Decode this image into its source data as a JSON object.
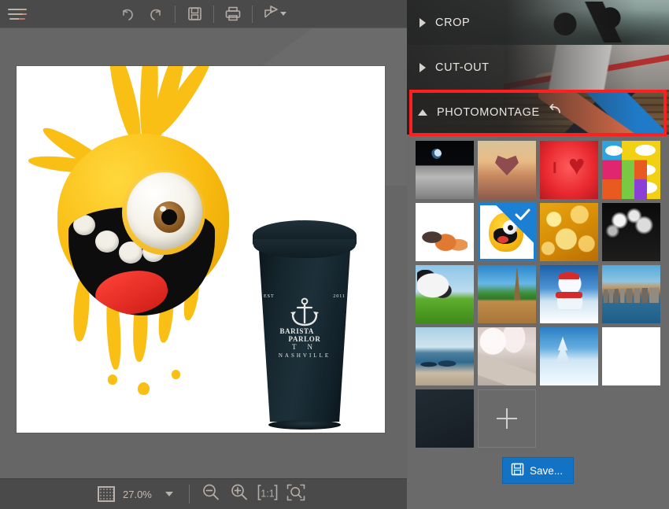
{
  "app": {
    "zoom_level": "27.0%"
  },
  "toolbar": {
    "menu_icon": "hamburger-menu-icon",
    "undo_label": "Undo",
    "redo_label": "Redo",
    "save_label": "Save",
    "print_label": "Print",
    "share_label": "Share",
    "share_caret": "▾"
  },
  "statusbar": {
    "zoom_value": "27.0%",
    "zoom_frame_icon": "zoom-region-icon",
    "zoom_out_label": "Zoom out",
    "zoom_in_label": "Zoom in",
    "actual_size_label": "1:1",
    "fit_screen_label": "Fit to screen"
  },
  "canvas": {
    "image_title": "Yellow monster and coffee cup",
    "cup_logo": {
      "brand_left": "BARISTA",
      "brand_right": "PARLOR",
      "state": "T  N",
      "city": "NASHVILLE",
      "est_left": "EST",
      "est_right": "2011"
    }
  },
  "panel": {
    "sections": [
      {
        "id": "crop",
        "label": "CROP",
        "expanded": false,
        "arrow": "chevron-right"
      },
      {
        "id": "cut-out",
        "label": "CUT-OUT",
        "expanded": false,
        "arrow": "chevron-right"
      },
      {
        "id": "photomontage",
        "label": "PHOTOMONTAGE",
        "expanded": true,
        "arrow": "chevron-down",
        "has_reset": true,
        "highlighted": true
      }
    ],
    "highlight_color": "#ff1f1f",
    "selection_color": "#1b7fd4",
    "thumbnails": [
      {
        "name": "moon-earth",
        "label": "Moon surface with Earth",
        "selected": false,
        "css": "t-moon"
      },
      {
        "name": "heart-tree",
        "label": "Heart-shaped tree at sunset",
        "selected": false,
        "css": "t-hearttree"
      },
      {
        "name": "i-love-heart",
        "label": "I love red heart grunge",
        "selected": false,
        "css": "t-ilove"
      },
      {
        "name": "comic-pop-art",
        "label": "Comic speech bubbles pop art",
        "selected": false,
        "css": "t-comic"
      },
      {
        "name": "pets-white",
        "label": "Cat and dogs on white",
        "selected": false,
        "css": "t-pets"
      },
      {
        "name": "yellow-monster",
        "label": "Yellow monster on white",
        "selected": true,
        "css": "t-monster"
      },
      {
        "name": "golden-bokeh",
        "label": "Golden bokeh lights",
        "selected": false,
        "css": "t-bokeh"
      },
      {
        "name": "concert-lights",
        "label": "Concert stage lights",
        "selected": false,
        "css": "t-concert"
      },
      {
        "name": "cow-meadow",
        "label": "Cow in green meadow",
        "selected": false,
        "css": "t-cow"
      },
      {
        "name": "paris-deck",
        "label": "Eiffel Tower with wooden deck",
        "selected": false,
        "css": "t-paris"
      },
      {
        "name": "snowman",
        "label": "Snowman with red hat and scarf",
        "selected": false,
        "css": "t-snowman"
      },
      {
        "name": "nyc-skyline",
        "label": "New York City skyline",
        "selected": false,
        "css": "t-nyc"
      },
      {
        "name": "venice-gondolas",
        "label": "Venice gondolas",
        "selected": false,
        "css": "t-venice"
      },
      {
        "name": "cherry-blossom",
        "label": "Cherry blossom boardwalk",
        "selected": false,
        "css": "t-blossom"
      },
      {
        "name": "winter-snow",
        "label": "Snowy winter landscape",
        "selected": false,
        "css": "t-winter"
      },
      {
        "name": "white-blank",
        "label": "Plain white background",
        "selected": false,
        "css": "t-white"
      },
      {
        "name": "dark-navy",
        "label": "Dark navy background",
        "selected": false,
        "css": "t-darknavy"
      }
    ],
    "add_tile": {
      "label": "+",
      "name": "add-background-tile"
    },
    "save_button": {
      "label": "Save...",
      "icon": "floppy-disk-icon",
      "color": "#1272c4"
    }
  }
}
